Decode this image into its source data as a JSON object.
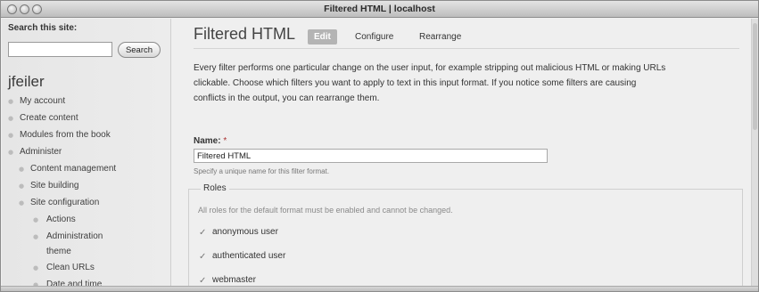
{
  "window": {
    "title": "Filtered HTML | localhost"
  },
  "sidebar": {
    "search_label": "Search this site:",
    "search_value": "",
    "search_button": "Search",
    "username": "jfeiler",
    "items": [
      {
        "label": "My account"
      },
      {
        "label": "Create content"
      },
      {
        "label": "Modules from the book"
      },
      {
        "label": "Administer"
      },
      {
        "label": "Content management"
      },
      {
        "label": "Site building"
      },
      {
        "label": "Site configuration"
      },
      {
        "label": "Actions"
      },
      {
        "label": "Administration"
      },
      {
        "label": "theme"
      },
      {
        "label": "Clean URLs"
      },
      {
        "label": "Date and time"
      }
    ]
  },
  "main": {
    "title": "Filtered HTML",
    "tabs": [
      {
        "label": "Edit",
        "active": true
      },
      {
        "label": "Configure"
      },
      {
        "label": "Rearrange"
      }
    ],
    "description_lines": [
      "Every filter performs one particular change on the user input, for example stripping out malicious HTML or making URLs",
      "clickable. Choose which filters you want to apply to text in this input format. If you notice some filters are causing",
      "conflicts in the output, you can rearrange them."
    ],
    "name_label": "Name:",
    "name_required": "*",
    "name_value": "Filtered HTML",
    "name_help": "Specify a unique name for this filter format.",
    "roles": {
      "legend": "Roles",
      "help": "All roles for the default format must be enabled and cannot be changed.",
      "items": [
        {
          "label": "anonymous user",
          "checked": true
        },
        {
          "label": "authenticated user",
          "checked": true
        },
        {
          "label": "webmaster",
          "checked": true
        }
      ]
    }
  }
}
